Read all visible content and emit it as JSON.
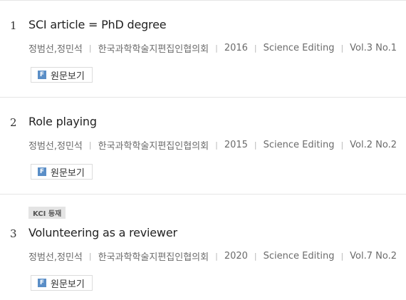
{
  "results": [
    {
      "number": "1",
      "title": "SCI article = PhD degree",
      "authors": "정범선,정민석",
      "publisher": "한국과학학술지편집인협의회",
      "year": "2016",
      "journal": "Science Editing",
      "volume": "Vol.3 No.1",
      "button_icon_text": "F",
      "button_label": "원문보기"
    },
    {
      "number": "2",
      "title": "Role playing",
      "authors": "정범선,정민석",
      "publisher": "한국과학학술지편집인협의회",
      "year": "2015",
      "journal": "Science Editing",
      "volume": "Vol.2 No.2",
      "button_icon_text": "F",
      "button_label": "원문보기"
    },
    {
      "number": "3",
      "badge": "KCI 등재",
      "title": "Volunteering as a reviewer",
      "authors": "정범선,정민석",
      "publisher": "한국과학학술지편집인협의회",
      "year": "2020",
      "journal": "Science Editing",
      "volume": "Vol.7 No.2",
      "button_icon_text": "F",
      "button_label": "원문보기"
    }
  ],
  "meta_separator": "|"
}
